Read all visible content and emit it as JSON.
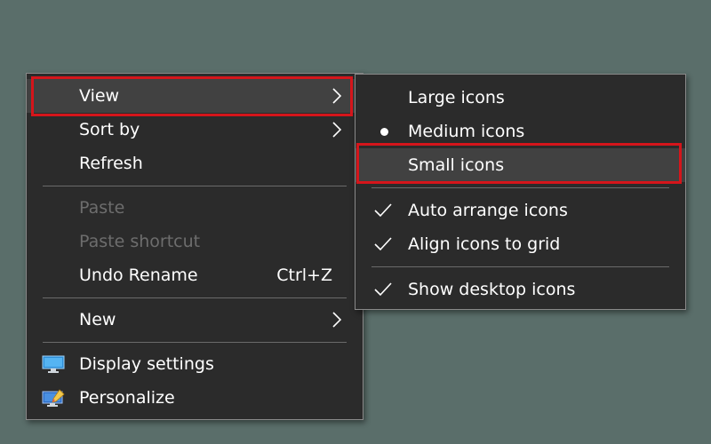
{
  "context_menu": {
    "view_label": "View",
    "sort_by_label": "Sort by",
    "refresh_label": "Refresh",
    "paste_label": "Paste",
    "paste_shortcut_label": "Paste shortcut",
    "undo_rename_label": "Undo Rename",
    "undo_rename_shortcut": "Ctrl+Z",
    "new_label": "New",
    "display_settings_label": "Display settings",
    "personalize_label": "Personalize",
    "disabled_items": [
      "Paste",
      "Paste shortcut"
    ],
    "icons": {
      "view": "chevron-right-icon",
      "sort_by": "chevron-right-icon",
      "new": "chevron-right-icon",
      "display_settings": "display-icon",
      "personalize": "personalize-icon"
    }
  },
  "view_submenu": {
    "large_icons_label": "Large icons",
    "medium_icons_label": "Medium icons",
    "small_icons_label": "Small icons",
    "auto_arrange_label": "Auto arrange icons",
    "align_grid_label": "Align icons to grid",
    "show_desktop_label": "Show desktop icons",
    "selected_size": "Medium icons",
    "checked": [
      "Auto arrange icons",
      "Align icons to grid",
      "Show desktop icons"
    ]
  },
  "colors": {
    "desktop_background": "#5a6e6a",
    "menu_background": "#2b2b2b",
    "hover_background": "#414141",
    "disabled_text": "#6d6d6d",
    "annotation_highlight": "#d5151b"
  }
}
